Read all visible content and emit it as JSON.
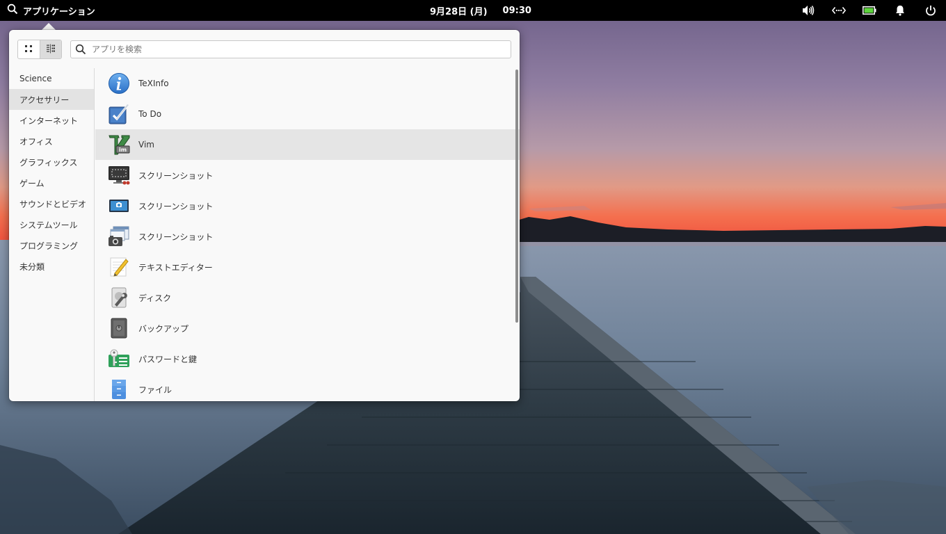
{
  "panel": {
    "applications_label": "アプリケーション",
    "date": "9月28日 (月)",
    "time": "09:30",
    "indicators": [
      "volume-icon",
      "network-icon",
      "battery-icon",
      "notifications-icon",
      "power-icon"
    ]
  },
  "launcher": {
    "search_placeholder": "アプリを検索",
    "view_modes": [
      "grid-view-icon",
      "category-view-icon"
    ],
    "active_view": "category-view",
    "categories": [
      {
        "label": "Science"
      },
      {
        "label": "アクセサリー",
        "selected": true
      },
      {
        "label": "インターネット"
      },
      {
        "label": "オフィス"
      },
      {
        "label": "グラフィックス"
      },
      {
        "label": "ゲーム"
      },
      {
        "label": "サウンドとビデオ"
      },
      {
        "label": "システムツール"
      },
      {
        "label": "プログラミング"
      },
      {
        "label": "未分類"
      }
    ],
    "apps": [
      {
        "label": "TeXInfo",
        "icon": "info-icon"
      },
      {
        "label": "To Do",
        "icon": "todo-checkbox-icon"
      },
      {
        "label": "Vim",
        "icon": "vim-icon",
        "selected": true
      },
      {
        "label": "スクリーンショット",
        "icon": "screenshot-monitor-icon"
      },
      {
        "label": "スクリーンショット",
        "icon": "screenshot-camera-icon"
      },
      {
        "label": "スクリーンショット",
        "icon": "screenshot-windows-icon"
      },
      {
        "label": "テキストエディター",
        "icon": "text-editor-icon"
      },
      {
        "label": "ディスク",
        "icon": "disk-utility-icon"
      },
      {
        "label": "バックアップ",
        "icon": "backup-safe-icon"
      },
      {
        "label": "パスワードと鍵",
        "icon": "passwords-keys-icon"
      },
      {
        "label": "ファイル",
        "icon": "file-cabinet-icon"
      }
    ]
  },
  "colors": {
    "panel_bg": "#000000",
    "launcher_bg": "#f9f9f9",
    "selected_row": "#e5e5e5",
    "sunset": "#f26b4f"
  }
}
